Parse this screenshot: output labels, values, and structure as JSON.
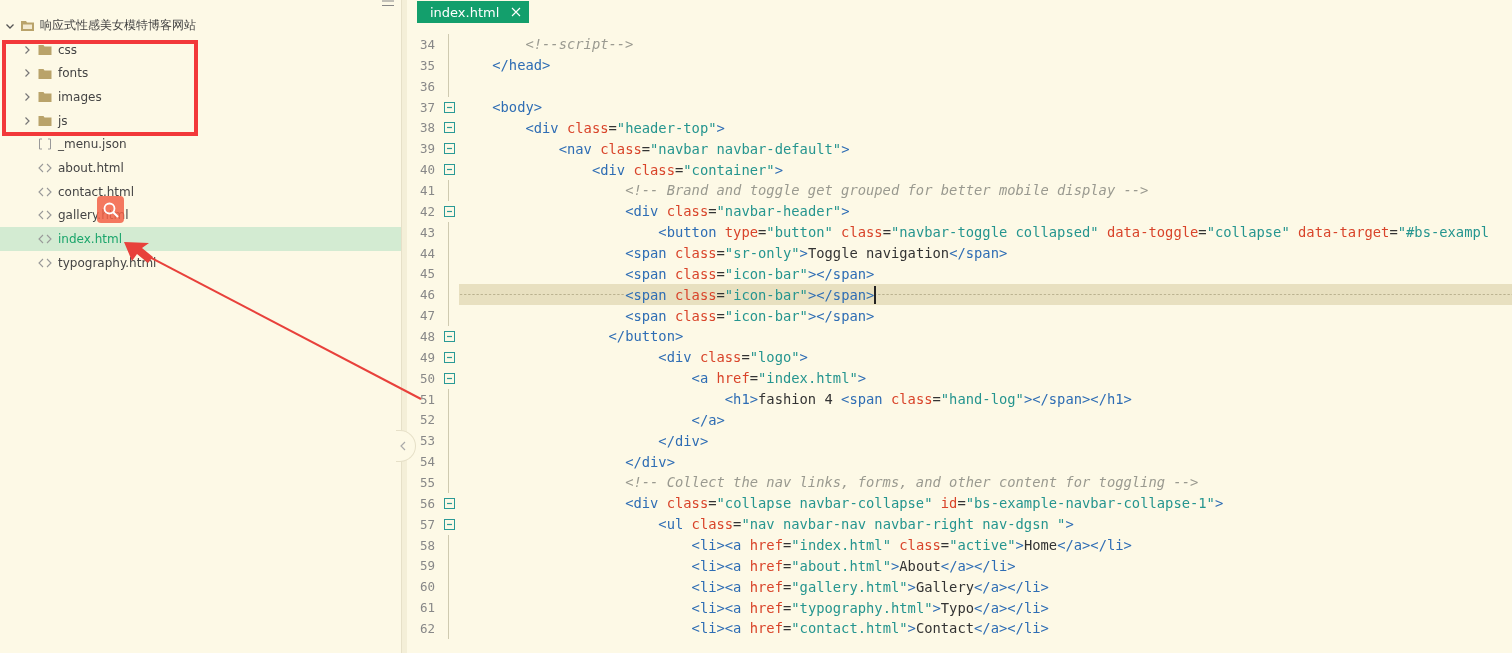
{
  "sidebar": {
    "project": {
      "label": "响应式性感美女模特博客网站",
      "expanded": true,
      "children": [
        {
          "label": "css",
          "kind": "folder",
          "expanded": false,
          "selected": false
        },
        {
          "label": "fonts",
          "kind": "folder",
          "expanded": false,
          "selected": false
        },
        {
          "label": "images",
          "kind": "folder",
          "expanded": false,
          "selected": false
        },
        {
          "label": "js",
          "kind": "folder",
          "expanded": false,
          "selected": false
        },
        {
          "label": "_menu.json",
          "kind": "json",
          "selected": false
        },
        {
          "label": "about.html",
          "kind": "html",
          "selected": false
        },
        {
          "label": "contact.html",
          "kind": "html",
          "selected": false
        },
        {
          "label": "gallery.html",
          "kind": "html",
          "selected": false
        },
        {
          "label": "index.html",
          "kind": "html",
          "selected": true
        },
        {
          "label": "typography.html",
          "kind": "html",
          "selected": false
        }
      ]
    }
  },
  "tabs": [
    {
      "label": "index.html",
      "selected": true
    }
  ],
  "editor": {
    "lines": [
      {
        "number": "34",
        "foldable": false,
        "current": false,
        "segments": [
          {
            "kind": "comment",
            "text": "        <!--script-->"
          }
        ]
      },
      {
        "number": "35",
        "foldable": false,
        "current": false,
        "segments": [
          {
            "kind": "tag",
            "text": "    </head>"
          }
        ]
      },
      {
        "number": "36",
        "foldable": false,
        "current": false
      },
      {
        "number": "37",
        "foldable": true,
        "current": false,
        "segments": [
          {
            "kind": "tag",
            "text": "    <body>"
          }
        ]
      },
      {
        "number": "38",
        "foldable": true,
        "current": false,
        "segments": [
          {
            "kind": "tag",
            "text": "        <div"
          },
          {
            "kind": "attr",
            "text": " class"
          },
          {
            "kind": "plain",
            "text": "="
          },
          {
            "kind": "string",
            "text": "\"header-top\""
          },
          {
            "kind": "tag",
            "text": ">"
          }
        ]
      },
      {
        "number": "39",
        "foldable": true,
        "current": false,
        "segments": [
          {
            "kind": "tag",
            "text": "            <nav"
          },
          {
            "kind": "attr",
            "text": " class"
          },
          {
            "kind": "plain",
            "text": "="
          },
          {
            "kind": "string",
            "text": "\"navbar navbar-default\""
          },
          {
            "kind": "tag",
            "text": ">"
          }
        ]
      },
      {
        "number": "40",
        "foldable": true,
        "current": false,
        "segments": [
          {
            "kind": "tag",
            "text": "                <div"
          },
          {
            "kind": "attr",
            "text": " class"
          },
          {
            "kind": "plain",
            "text": "="
          },
          {
            "kind": "string",
            "text": "\"container\""
          },
          {
            "kind": "tag",
            "text": ">"
          }
        ]
      },
      {
        "number": "41",
        "foldable": false,
        "current": false,
        "segments": [
          {
            "kind": "comment",
            "text": "                    <!-- Brand and toggle get grouped for better mobile display -->"
          }
        ]
      },
      {
        "number": "42",
        "foldable": true,
        "current": false,
        "segments": [
          {
            "kind": "tag",
            "text": "                    <div"
          },
          {
            "kind": "attr",
            "text": " class"
          },
          {
            "kind": "plain",
            "text": "="
          },
          {
            "kind": "string",
            "text": "\"navbar-header\""
          },
          {
            "kind": "tag",
            "text": ">"
          }
        ]
      },
      {
        "number": "43",
        "foldable": false,
        "current": false,
        "segments": [
          {
            "kind": "tag",
            "text": "                        <button"
          },
          {
            "kind": "attr",
            "text": " type"
          },
          {
            "kind": "plain",
            "text": "="
          },
          {
            "kind": "string",
            "text": "\"button\""
          },
          {
            "kind": "attr",
            "text": " class"
          },
          {
            "kind": "plain",
            "text": "="
          },
          {
            "kind": "string",
            "text": "\"navbar-toggle collapsed\""
          },
          {
            "kind": "attr",
            "text": " data-toggle"
          },
          {
            "kind": "plain",
            "text": "="
          },
          {
            "kind": "string",
            "text": "\"collapse\""
          },
          {
            "kind": "attr",
            "text": " data-target"
          },
          {
            "kind": "plain",
            "text": "="
          },
          {
            "kind": "string",
            "text": "\"#bs-exampl"
          }
        ]
      },
      {
        "number": "44",
        "foldable": false,
        "current": false,
        "segments": [
          {
            "kind": "tag",
            "text": "                    <span"
          },
          {
            "kind": "attr",
            "text": " class"
          },
          {
            "kind": "plain",
            "text": "="
          },
          {
            "kind": "string",
            "text": "\"sr-only\""
          },
          {
            "kind": "tag",
            "text": ">"
          },
          {
            "kind": "plain",
            "text": "Toggle navigation"
          },
          {
            "kind": "tag",
            "text": "</span>"
          }
        ]
      },
      {
        "number": "45",
        "foldable": false,
        "current": false,
        "segments": [
          {
            "kind": "tag",
            "text": "                    <span"
          },
          {
            "kind": "attr",
            "text": " class"
          },
          {
            "kind": "plain",
            "text": "="
          },
          {
            "kind": "string",
            "text": "\"icon-bar\""
          },
          {
            "kind": "tag",
            "text": "></span>"
          }
        ]
      },
      {
        "number": "46",
        "foldable": false,
        "current": true,
        "segments": [
          {
            "kind": "tag",
            "text": "                    <span"
          },
          {
            "kind": "attr",
            "text": " class"
          },
          {
            "kind": "plain",
            "text": "="
          },
          {
            "kind": "string",
            "text": "\"icon-bar\""
          },
          {
            "kind": "tag",
            "text": "></span>"
          }
        ]
      },
      {
        "number": "47",
        "foldable": false,
        "current": false,
        "segments": [
          {
            "kind": "tag",
            "text": "                    <span"
          },
          {
            "kind": "attr",
            "text": " class"
          },
          {
            "kind": "plain",
            "text": "="
          },
          {
            "kind": "string",
            "text": "\"icon-bar\""
          },
          {
            "kind": "tag",
            "text": "></span>"
          }
        ]
      },
      {
        "number": "48",
        "foldable": true,
        "current": false,
        "segments": [
          {
            "kind": "tag",
            "text": "                  </button>"
          }
        ]
      },
      {
        "number": "49",
        "foldable": true,
        "current": false,
        "segments": [
          {
            "kind": "tag",
            "text": "                        <div"
          },
          {
            "kind": "attr",
            "text": " class"
          },
          {
            "kind": "plain",
            "text": "="
          },
          {
            "kind": "string",
            "text": "\"logo\""
          },
          {
            "kind": "tag",
            "text": ">"
          }
        ]
      },
      {
        "number": "50",
        "foldable": true,
        "current": false,
        "segments": [
          {
            "kind": "tag",
            "text": "                            <a"
          },
          {
            "kind": "attr",
            "text": " href"
          },
          {
            "kind": "plain",
            "text": "="
          },
          {
            "kind": "string",
            "text": "\"index.html\""
          },
          {
            "kind": "tag",
            "text": ">"
          }
        ]
      },
      {
        "number": "51",
        "foldable": false,
        "current": false,
        "segments": [
          {
            "kind": "tag",
            "text": "                                <h1>"
          },
          {
            "kind": "plain",
            "text": "fashion 4 "
          },
          {
            "kind": "tag",
            "text": "<span"
          },
          {
            "kind": "attr",
            "text": " class"
          },
          {
            "kind": "plain",
            "text": "="
          },
          {
            "kind": "string",
            "text": "\"hand-log\""
          },
          {
            "kind": "tag",
            "text": "></span></h1>"
          }
        ]
      },
      {
        "number": "52",
        "foldable": false,
        "current": false,
        "segments": [
          {
            "kind": "tag",
            "text": "                            </a>"
          }
        ]
      },
      {
        "number": "53",
        "foldable": false,
        "current": false,
        "segments": [
          {
            "kind": "tag",
            "text": "                        </div>"
          }
        ]
      },
      {
        "number": "54",
        "foldable": false,
        "current": false,
        "segments": [
          {
            "kind": "tag",
            "text": "                    </div>"
          }
        ]
      },
      {
        "number": "55",
        "foldable": false,
        "current": false,
        "segments": [
          {
            "kind": "comment",
            "text": "                    <!-- Collect the nav links, forms, and other content for toggling -->"
          }
        ]
      },
      {
        "number": "56",
        "foldable": true,
        "current": false,
        "segments": [
          {
            "kind": "tag",
            "text": "                    <div"
          },
          {
            "kind": "attr",
            "text": " class"
          },
          {
            "kind": "plain",
            "text": "="
          },
          {
            "kind": "string",
            "text": "\"collapse navbar-collapse\""
          },
          {
            "kind": "attr",
            "text": " id"
          },
          {
            "kind": "plain",
            "text": "="
          },
          {
            "kind": "string",
            "text": "\"bs-example-navbar-collapse-1\""
          },
          {
            "kind": "tag",
            "text": ">"
          }
        ]
      },
      {
        "number": "57",
        "foldable": true,
        "current": false,
        "segments": [
          {
            "kind": "tag",
            "text": "                        <ul"
          },
          {
            "kind": "attr",
            "text": " class"
          },
          {
            "kind": "plain",
            "text": "="
          },
          {
            "kind": "string",
            "text": "\"nav navbar-nav navbar-right nav-dgsn \""
          },
          {
            "kind": "tag",
            "text": ">"
          }
        ]
      },
      {
        "number": "58",
        "foldable": false,
        "current": false,
        "segments": [
          {
            "kind": "tag",
            "text": "                            <li><a"
          },
          {
            "kind": "attr",
            "text": " href"
          },
          {
            "kind": "plain",
            "text": "="
          },
          {
            "kind": "string",
            "text": "\"index.html\""
          },
          {
            "kind": "attr",
            "text": " class"
          },
          {
            "kind": "plain",
            "text": "="
          },
          {
            "kind": "string",
            "text": "\"active\""
          },
          {
            "kind": "tag",
            "text": ">"
          },
          {
            "kind": "plain",
            "text": "Home"
          },
          {
            "kind": "tag",
            "text": "</a></li>"
          }
        ]
      },
      {
        "number": "59",
        "foldable": false,
        "current": false,
        "segments": [
          {
            "kind": "tag",
            "text": "                            <li><a"
          },
          {
            "kind": "attr",
            "text": " href"
          },
          {
            "kind": "plain",
            "text": "="
          },
          {
            "kind": "string",
            "text": "\"about.html\""
          },
          {
            "kind": "tag",
            "text": ">"
          },
          {
            "kind": "plain",
            "text": "About"
          },
          {
            "kind": "tag",
            "text": "</a></li>"
          }
        ]
      },
      {
        "number": "60",
        "foldable": false,
        "current": false,
        "segments": [
          {
            "kind": "tag",
            "text": "                            <li><a"
          },
          {
            "kind": "attr",
            "text": " href"
          },
          {
            "kind": "plain",
            "text": "="
          },
          {
            "kind": "string",
            "text": "\"gallery.html\""
          },
          {
            "kind": "tag",
            "text": ">"
          },
          {
            "kind": "plain",
            "text": "Gallery"
          },
          {
            "kind": "tag",
            "text": "</a></li>"
          }
        ]
      },
      {
        "number": "61",
        "foldable": false,
        "current": false,
        "segments": [
          {
            "kind": "tag",
            "text": "                            <li><a"
          },
          {
            "kind": "attr",
            "text": " href"
          },
          {
            "kind": "plain",
            "text": "="
          },
          {
            "kind": "string",
            "text": "\"typography.html\""
          },
          {
            "kind": "tag",
            "text": ">"
          },
          {
            "kind": "plain",
            "text": "Typo"
          },
          {
            "kind": "tag",
            "text": "</a></li>"
          }
        ]
      },
      {
        "number": "62",
        "foldable": false,
        "current": false,
        "segments": [
          {
            "kind": "tag",
            "text": "                            <li><a"
          },
          {
            "kind": "attr",
            "text": " href"
          },
          {
            "kind": "plain",
            "text": "="
          },
          {
            "kind": "string",
            "text": "\"contact.html\""
          },
          {
            "kind": "tag",
            "text": ">"
          },
          {
            "kind": "plain",
            "text": "Contact"
          },
          {
            "kind": "tag",
            "text": "</a></li>"
          }
        ]
      }
    ]
  },
  "annotations": [
    {
      "kind": "box"
    },
    {
      "kind": "arrow"
    },
    {
      "kind": "search-badge"
    }
  ]
}
